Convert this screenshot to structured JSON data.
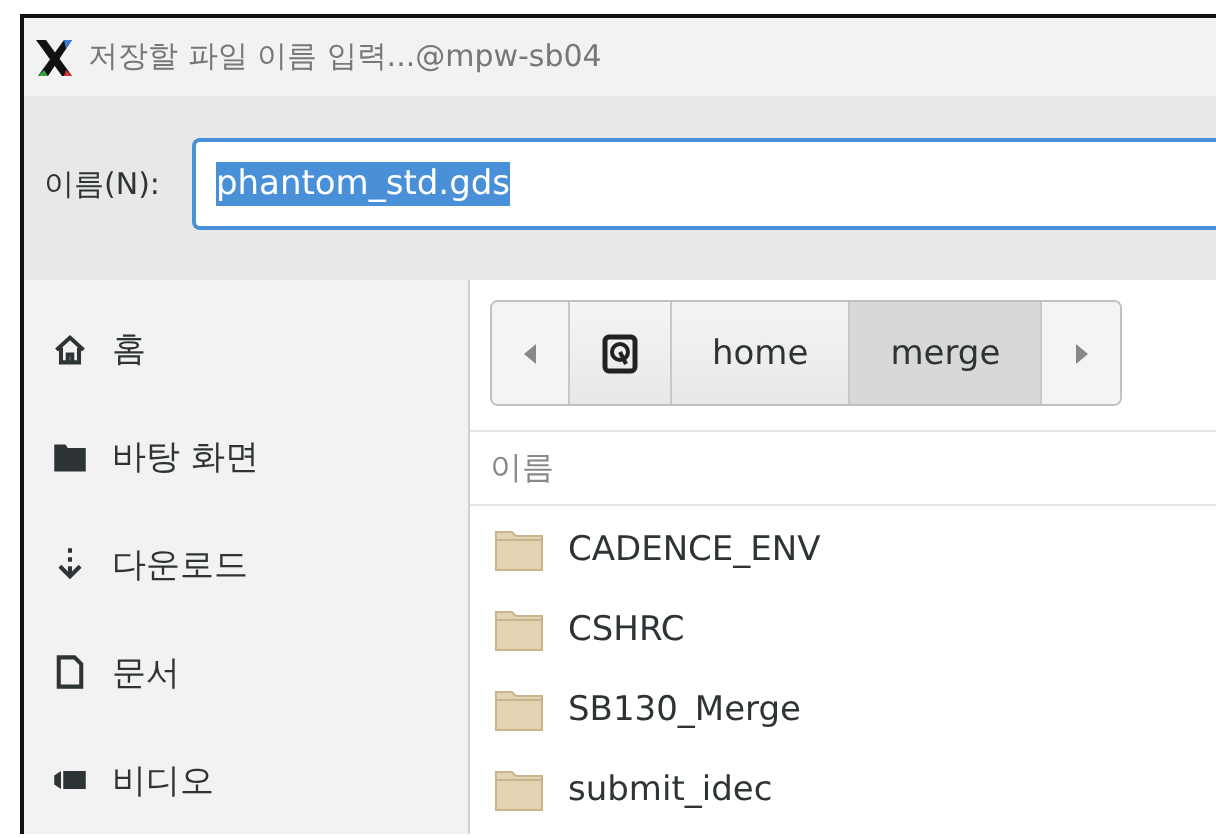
{
  "window": {
    "title": "저장할 파일 이름 입력...@mpw-sb04"
  },
  "name_field": {
    "label": "이름(N):",
    "value": "phantom_std.gds",
    "text_selected": true
  },
  "sidebar": {
    "items": [
      {
        "label": "홈",
        "kind": "home"
      },
      {
        "label": "바탕 화면",
        "kind": "desktop"
      },
      {
        "label": "다운로드",
        "kind": "download"
      },
      {
        "label": "문서",
        "kind": "documents"
      },
      {
        "label": "비디오",
        "kind": "videos"
      }
    ]
  },
  "path_bar": {
    "items": [
      {
        "kind": "back"
      },
      {
        "kind": "drive",
        "selected": false
      },
      {
        "kind": "folder",
        "label": "home",
        "selected": false
      },
      {
        "kind": "folder",
        "label": "merge",
        "selected": true
      },
      {
        "kind": "forward"
      }
    ]
  },
  "file_list": {
    "columns": [
      "이름"
    ],
    "rows": [
      {
        "name": "CADENCE_ENV"
      },
      {
        "name": "CSHRC"
      },
      {
        "name": "SB130_Merge"
      },
      {
        "name": "submit_idec"
      }
    ]
  }
}
